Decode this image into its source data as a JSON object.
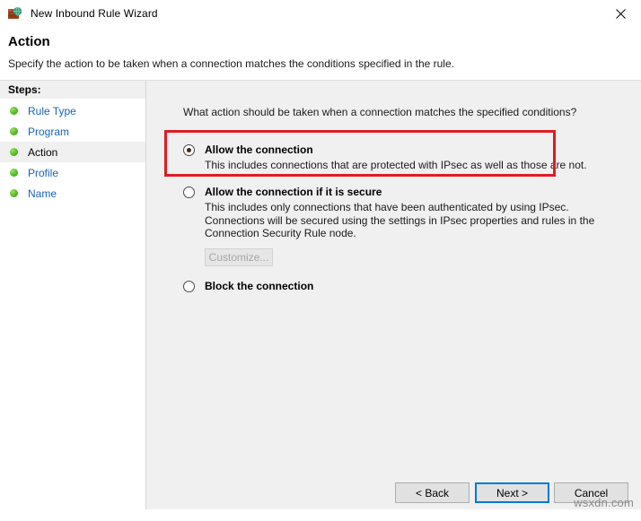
{
  "window": {
    "title": "New Inbound Rule Wizard",
    "icon": "firewall-icon",
    "close_label": "✕"
  },
  "header": {
    "title": "Action",
    "subtitle": "Specify the action to be taken when a connection matches the conditions specified in the rule."
  },
  "sidebar": {
    "heading": "Steps:",
    "items": [
      {
        "label": "Rule Type",
        "current": false
      },
      {
        "label": "Program",
        "current": false
      },
      {
        "label": "Action",
        "current": true
      },
      {
        "label": "Profile",
        "current": false
      },
      {
        "label": "Name",
        "current": false
      }
    ]
  },
  "main": {
    "question": "What action should be taken when a connection matches the specified conditions?",
    "options": [
      {
        "id": "allow",
        "title": "Allow the connection",
        "description": "This includes connections that are protected with IPsec as well as those are not.",
        "selected": true,
        "highlighted": true
      },
      {
        "id": "allow-if-secure",
        "title": "Allow the connection if it is secure",
        "description": "This includes only connections that have been authenticated by using IPsec.  Connections will be secured using the settings in IPsec properties and rules in the Connection Security Rule node.",
        "selected": false,
        "highlighted": false,
        "button": {
          "label": "Customize...",
          "disabled": true
        }
      },
      {
        "id": "block",
        "title": "Block the connection",
        "description": "",
        "selected": false,
        "highlighted": false
      }
    ]
  },
  "footer": {
    "back_label": "< Back",
    "next_label": "Next >",
    "cancel_label": "Cancel"
  },
  "watermark": "wsxdn.com",
  "colors": {
    "annotation": "#e01b24",
    "link": "#1763b5",
    "focus": "#0078d7",
    "content_bg": "#f0f0f0"
  }
}
